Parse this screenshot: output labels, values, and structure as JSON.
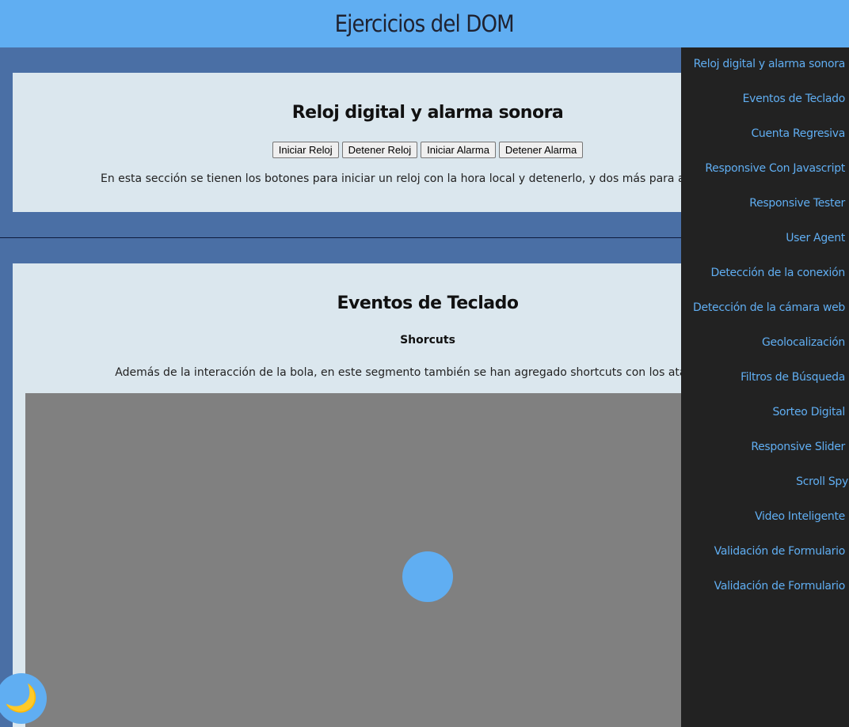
{
  "header": {
    "title": "Ejercicios del DOM"
  },
  "clock_section": {
    "title": "Reloj digital y alarma sonora",
    "buttons": [
      "Iniciar Reloj",
      "Detener Reloj",
      "Iniciar Alarma",
      "Detener Alarma"
    ],
    "description": "En esta sección se tienen los botones para iniciar un reloj con la hora local y detenerlo, y dos más para activar y dete"
  },
  "keyboard_section": {
    "title": "Eventos de Teclado",
    "subtitle": "Shorcuts",
    "description": "Además de la interacción de la bola, en este segmento también se han agregado shortcuts con los atajos alt + ("
  },
  "menu": {
    "items": [
      "Reloj digital y alarma sonora",
      "Eventos de Teclado",
      "Cuenta Regresiva",
      "Responsive Con Javascript",
      "Responsive Tester",
      "User Agent",
      "Detección de la conexión",
      "Detección de la cámara web",
      "Geolocalización",
      "Filtros de Búsqueda",
      "Sorteo Digital",
      "Responsive Slider",
      "Scroll Spy",
      "Video Inteligente",
      "Validación de Formulario",
      "Validación de Formulario"
    ]
  },
  "theme_toggle": {
    "icon": "moon-icon",
    "glyph": "🌙"
  },
  "colors": {
    "accent": "#60aef2",
    "menu_bg": "#222222",
    "page_bg": "#4a6fa5",
    "section_bg": "#dbe7ee",
    "stage_bg": "#808080"
  }
}
